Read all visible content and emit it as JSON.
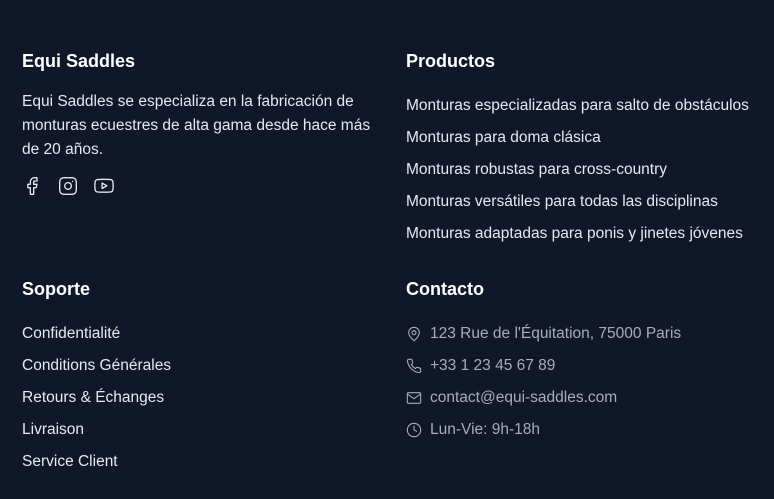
{
  "brand": {
    "title": "Equi Saddles",
    "description": "Equi Saddles se especializa en la fabricación de monturas ecuestres de alta gama desde hace más de 20 años.",
    "social_icons": [
      "facebook-icon",
      "instagram-icon",
      "youtube-icon"
    ]
  },
  "products": {
    "title": "Productos",
    "items": [
      "Monturas especializadas para salto de obstáculos",
      "Monturas para doma clásica",
      "Monturas robustas para cross-country",
      "Monturas versátiles para todas las disciplinas",
      "Monturas adaptadas para ponis y jinetes jóvenes"
    ]
  },
  "support": {
    "title": "Soporte",
    "items": [
      "Confidentialité",
      "Conditions Générales",
      "Retours & Échanges",
      "Livraison",
      "Service Client"
    ]
  },
  "contact": {
    "title": "Contacto",
    "address": "123 Rue de l'Équitation, 75000 Paris",
    "phone": "+33 1 23 45 67 89",
    "email": "contact@equi-saddles.com",
    "hours": "Lun-Vie: 9h-18h"
  },
  "colors": {
    "background": "#0f1729",
    "heading": "#ffffff",
    "text": "#e6e9ef",
    "muted": "#a7adb8"
  }
}
